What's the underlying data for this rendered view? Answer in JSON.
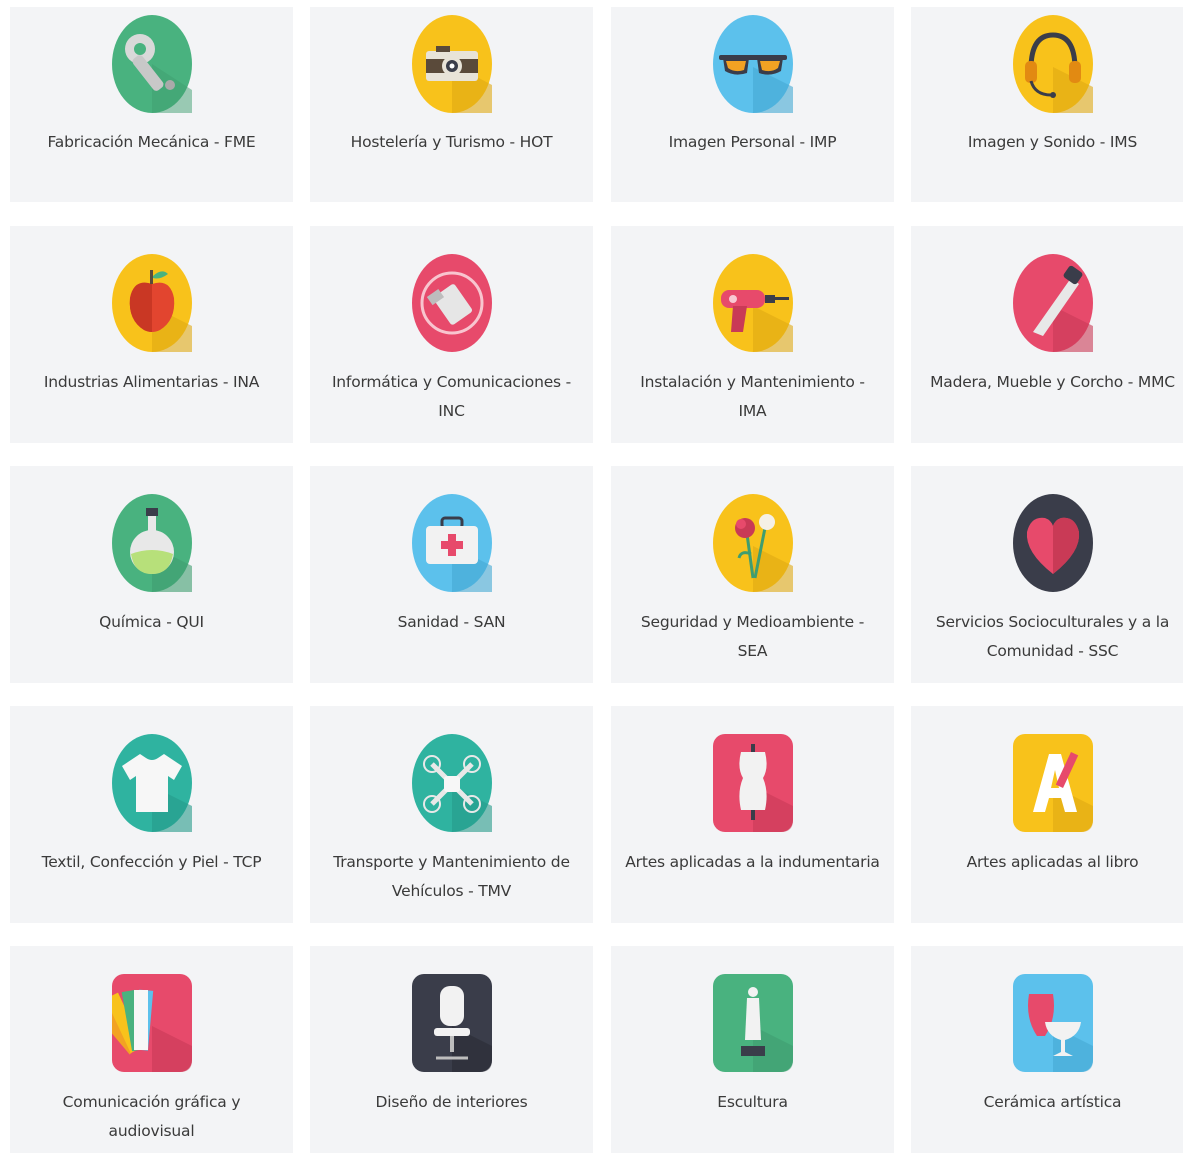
{
  "categories": [
    {
      "label": "Fabricación Mecánica - FME",
      "icon": "wrench-icon",
      "color": "#49b27f"
    },
    {
      "label": "Hostelería y Turismo - HOT",
      "icon": "camera-icon",
      "color": "#f8c21b"
    },
    {
      "label": "Imagen Personal - IMP",
      "icon": "sunglasses-icon",
      "color": "#5cc1ec"
    },
    {
      "label": "Imagen y Sonido - IMS",
      "icon": "headphones-icon",
      "color": "#f8c21b"
    },
    {
      "label": "Industrias Alimentarias - INA",
      "icon": "apple-icon",
      "color": "#f8c21b"
    },
    {
      "label": "Informática y Comunicaciones - INC",
      "icon": "usb-drive-icon",
      "color": "#e74a6b"
    },
    {
      "label": "Instalación y Mantenimiento - IMA",
      "icon": "drill-icon",
      "color": "#f8c21b"
    },
    {
      "label": "Madera, Mueble y Corcho - MMC",
      "icon": "saw-icon",
      "color": "#e74a6b"
    },
    {
      "label": "Química - QUI",
      "icon": "flask-icon",
      "color": "#49b27f"
    },
    {
      "label": "Sanidad - SAN",
      "icon": "first-aid-kit-icon",
      "color": "#5cc1ec"
    },
    {
      "label": "Seguridad y Medioambiente - SEA",
      "icon": "flowers-icon",
      "color": "#f8c21b"
    },
    {
      "label": "Servicios Socioculturales y a la Comunidad - SSC",
      "icon": "heart-icon",
      "color": "#3a3d4a"
    },
    {
      "label": "Textil, Confección y Piel - TCP",
      "icon": "tshirt-icon",
      "color": "#2fb3a0"
    },
    {
      "label": "Transporte y Mantenimiento de Vehículos - TMV",
      "icon": "drone-icon",
      "color": "#2fb3a0"
    },
    {
      "label": "Artes aplicadas a la indumentaria",
      "icon": "mannequin-icon",
      "color": "#e74a6b"
    },
    {
      "label": "Artes aplicadas al libro",
      "icon": "letter-a-pencil-icon",
      "color": "#f8c21b"
    },
    {
      "label": "Comunicación gráfica y audiovisual",
      "icon": "color-swatch-icon",
      "color": "#e74a6b"
    },
    {
      "label": "Diseño de interiores",
      "icon": "office-chair-icon",
      "color": "#3a3d4a"
    },
    {
      "label": "Escultura",
      "icon": "statue-icon",
      "color": "#49b27f"
    },
    {
      "label": "Cerámica artística",
      "icon": "vase-icon",
      "color": "#5cc1ec"
    }
  ]
}
